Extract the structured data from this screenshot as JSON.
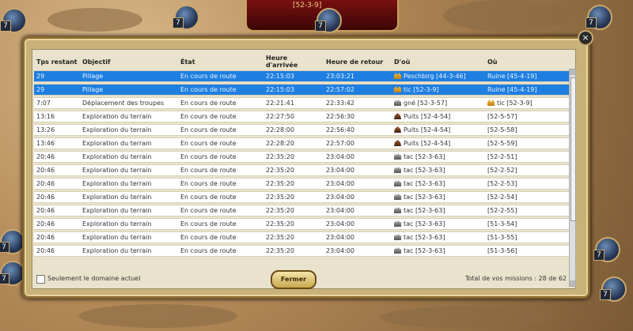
{
  "banner": {
    "coords": "[52-3-9]"
  },
  "table": {
    "headers": [
      "Tps restant",
      "Objectif",
      "État",
      "Heure d'arrivée",
      "Heure de retour",
      "D'où",
      "Où"
    ],
    "rows": [
      {
        "time": "29",
        "objective": "Pillage",
        "state": "En cours de route",
        "arrival": "22:15:03",
        "return": "23:03:21",
        "from": "Peschbirg [44-3-46]",
        "from_icon": "gold-castle-icon",
        "to": "Ruine [45-4-19]",
        "to_icon": "",
        "selected": true
      },
      {
        "time": "29",
        "objective": "Pillage",
        "state": "En cours de route",
        "arrival": "22:15:03",
        "return": "22:57:02",
        "from": "tic [52-3-9]",
        "from_icon": "gold-castle-icon",
        "to": "Ruine [45-4-19]",
        "to_icon": "",
        "selected": true
      },
      {
        "time": "7:07",
        "objective": "Déplacement des troupes",
        "state": "En cours de route",
        "arrival": "22:21:41",
        "return": "22:33:42",
        "from": "gné [52-3-57]",
        "from_icon": "grey-castle-icon",
        "to": "tic [52-3-9]",
        "to_icon": "gold-castle-icon",
        "selected": false
      },
      {
        "time": "13:16",
        "objective": "Exploration du terrain",
        "state": "En cours de route",
        "arrival": "22:27:50",
        "return": "22:56:30",
        "from": "Puits [52-4-54]",
        "from_icon": "pit-icon",
        "to": "[52-5-57]",
        "to_icon": "",
        "selected": false
      },
      {
        "time": "13:26",
        "objective": "Exploration du terrain",
        "state": "En cours de route",
        "arrival": "22:28:00",
        "return": "22:56:40",
        "from": "Puits [52-4-54]",
        "from_icon": "pit-icon",
        "to": "[52-5-58]",
        "to_icon": "",
        "selected": false
      },
      {
        "time": "13:46",
        "objective": "Exploration du terrain",
        "state": "En cours de route",
        "arrival": "22:28:20",
        "return": "22:57:00",
        "from": "Puits [52-4-54]",
        "from_icon": "pit-icon",
        "to": "[52-5-59]",
        "to_icon": "",
        "selected": false
      },
      {
        "time": "20:46",
        "objective": "Exploration du terrain",
        "state": "En cours de route",
        "arrival": "22:35:20",
        "return": "23:04:00",
        "from": "tac [52-3-63]",
        "from_icon": "grey-castle-icon",
        "to": "[52-2-51]",
        "to_icon": "",
        "selected": false
      },
      {
        "time": "20:46",
        "objective": "Exploration du terrain",
        "state": "En cours de route",
        "arrival": "22:35:20",
        "return": "23:04:00",
        "from": "tac [52-3-63]",
        "from_icon": "grey-castle-icon",
        "to": "[52-2-52]",
        "to_icon": "",
        "selected": false
      },
      {
        "time": "20:46",
        "objective": "Exploration du terrain",
        "state": "En cours de route",
        "arrival": "22:35:20",
        "return": "23:04:00",
        "from": "tac [52-3-63]",
        "from_icon": "grey-castle-icon",
        "to": "[52-2-53]",
        "to_icon": "",
        "selected": false
      },
      {
        "time": "20:46",
        "objective": "Exploration du terrain",
        "state": "En cours de route",
        "arrival": "22:35:20",
        "return": "23:04:00",
        "from": "tac [52-3-63]",
        "from_icon": "grey-castle-icon",
        "to": "[52-2-54]",
        "to_icon": "",
        "selected": false
      },
      {
        "time": "20:46",
        "objective": "Exploration du terrain",
        "state": "En cours de route",
        "arrival": "22:35:20",
        "return": "23:04:00",
        "from": "tac [52-3-63]",
        "from_icon": "grey-castle-icon",
        "to": "[52-2-55]",
        "to_icon": "",
        "selected": false
      },
      {
        "time": "20:46",
        "objective": "Exploration du terrain",
        "state": "En cours de route",
        "arrival": "22:35:20",
        "return": "23:04:00",
        "from": "tac [52-3-63]",
        "from_icon": "grey-castle-icon",
        "to": "[51-3-54]",
        "to_icon": "",
        "selected": false
      },
      {
        "time": "20:46",
        "objective": "Exploration du terrain",
        "state": "En cours de route",
        "arrival": "22:35:20",
        "return": "23:04:00",
        "from": "tac [52-3-63]",
        "from_icon": "grey-castle-icon",
        "to": "[51-3-55]",
        "to_icon": "",
        "selected": false
      },
      {
        "time": "20:46",
        "objective": "Exploration du terrain",
        "state": "En cours de route",
        "arrival": "22:35:20",
        "return": "23:04:00",
        "from": "tac [52-3-63]",
        "from_icon": "grey-castle-icon",
        "to": "[51-3-56]",
        "to_icon": "",
        "selected": false
      }
    ]
  },
  "footer": {
    "checkbox_label": "Seulement le domaine actuel",
    "close_button": "Fermer",
    "total": "Total de vos missions : 28 de 62"
  },
  "colors": {
    "selected_row": "#1f7fe0",
    "dialog_frame": "#c9b27a"
  },
  "map_units": [
    {
      "level": "7"
    },
    {
      "level": "7"
    },
    {
      "level": "7"
    },
    {
      "level": "7"
    },
    {
      "level": "7"
    },
    {
      "level": "7"
    },
    {
      "level": "7"
    },
    {
      "level": "7"
    }
  ]
}
